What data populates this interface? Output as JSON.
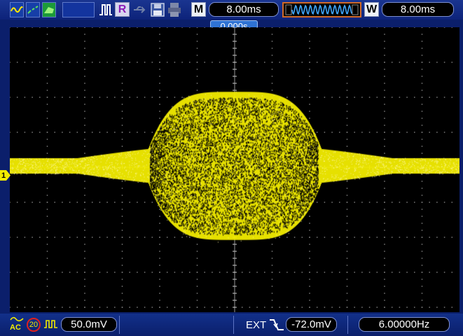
{
  "toolbar": {
    "run_mode_icons": [
      "sine-wave-icon",
      "scatter-icon",
      "persist-icon"
    ],
    "pulse_icon": "pulse-icon",
    "ref_label": "R",
    "usb_icon": "usb-icon",
    "save_icon": "floppy-disk-icon",
    "printer_icon": "printer-icon",
    "main_label": "M",
    "main_timebase": "8.00ms",
    "window_label": "W",
    "window_timebase": "8.00ms"
  },
  "screen": {
    "trigger_position": "0.000s",
    "channel_marker": "1",
    "trace_color": "#f2ec00",
    "grid_color": "#7a7a7a"
  },
  "statusbar": {
    "coupling": "AC",
    "bw_limit": "20",
    "ch1_scale": "50.0mV",
    "trigger_source": "EXT",
    "trigger_level": "-72.0mV",
    "frequency": "6.00000Hz"
  }
}
